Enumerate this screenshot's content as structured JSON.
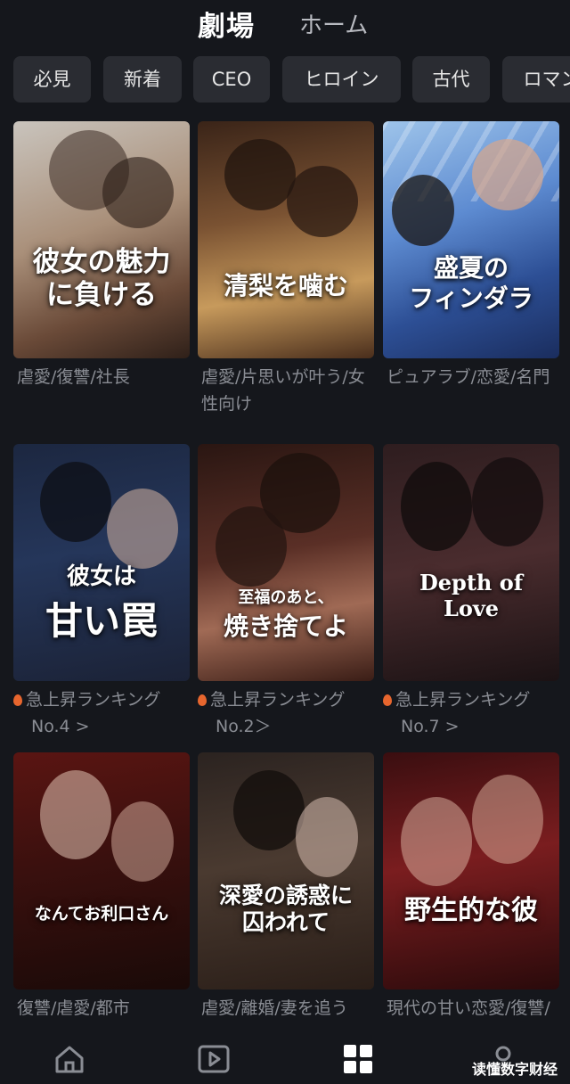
{
  "header": {
    "tab_active": "劇場",
    "tab_home": "ホーム"
  },
  "chips": [
    "必見",
    "新着",
    "CEO",
    "ヒロイン",
    "古代",
    "ロマン"
  ],
  "cards": [
    {
      "poster_title": "彼女の魅力\nに負ける",
      "tags": "虐愛/復讐/社長"
    },
    {
      "poster_title": "清梨を噛む",
      "tags": "虐愛/片思いが叶う/女性向け"
    },
    {
      "poster_title": "盛夏の\nフィンダラ",
      "tags": "ピュアラブ/恋愛/名門"
    },
    {
      "poster_title_small": "彼女は",
      "poster_title": "甘い罠",
      "rank_label": "急上昇ランキング",
      "rank_no": "No.4 >"
    },
    {
      "poster_title_small": "至福のあと、",
      "poster_title": "焼き捨てよ",
      "rank_label": "急上昇ランキング",
      "rank_no": "No.2＞"
    },
    {
      "poster_title": "Depth of Love",
      "rank_label": "急上昇ランキング",
      "rank_no": "No.7 >"
    },
    {
      "poster_title": "なんてお利口さん",
      "tags": "復讐/虐愛/都市"
    },
    {
      "poster_title": "深愛の誘惑に\n囚われて",
      "tags": "虐愛/離婚/妻を追う"
    },
    {
      "poster_title": "野生的な彼",
      "tags": "現代の甘い恋愛/復讐/甘い恋"
    }
  ],
  "nav": [
    "home-icon",
    "video-icon",
    "grid-icon",
    "profile-icon"
  ],
  "watermark": "读懂数字财经"
}
